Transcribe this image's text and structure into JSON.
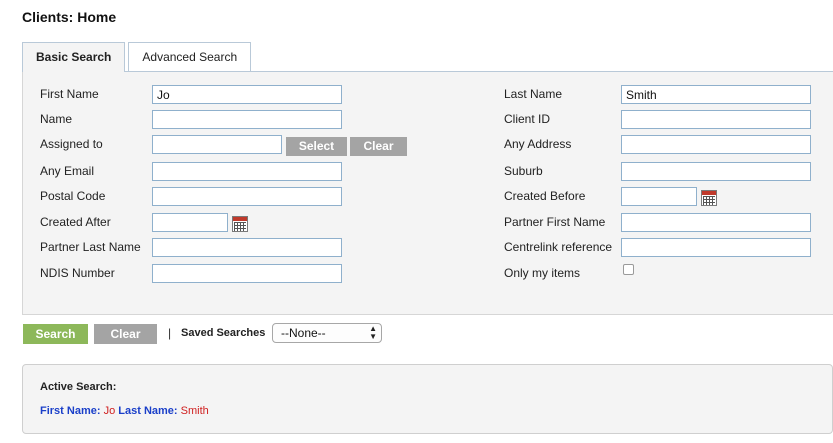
{
  "page": {
    "title": "Clients: Home"
  },
  "tabs": [
    {
      "label": "Basic Search",
      "active": true
    },
    {
      "label": "Advanced Search",
      "active": false
    }
  ],
  "form": {
    "first_name": {
      "label": "First Name",
      "value": "Jo"
    },
    "last_name": {
      "label": "Last Name",
      "value": "Smith"
    },
    "name": {
      "label": "Name",
      "value": ""
    },
    "client_id": {
      "label": "Client ID",
      "value": ""
    },
    "assigned_to": {
      "label": "Assigned to",
      "value": "",
      "select_label": "Select",
      "clear_label": "Clear"
    },
    "any_address": {
      "label": "Any Address",
      "value": ""
    },
    "any_email": {
      "label": "Any Email",
      "value": ""
    },
    "suburb": {
      "label": "Suburb",
      "value": ""
    },
    "postal_code": {
      "label": "Postal Code",
      "value": ""
    },
    "created_before": {
      "label": "Created Before",
      "value": ""
    },
    "created_after": {
      "label": "Created After",
      "value": ""
    },
    "partner_first_name": {
      "label": "Partner First Name",
      "value": ""
    },
    "partner_last_name": {
      "label": "Partner Last Name",
      "value": ""
    },
    "centrelink_reference": {
      "label": "Centrelink reference",
      "value": ""
    },
    "ndis_number": {
      "label": "NDIS Number",
      "value": ""
    },
    "only_my_items": {
      "label": "Only my items",
      "checked": false
    }
  },
  "actions": {
    "search_label": "Search",
    "clear_label": "Clear",
    "separator": "|",
    "saved_searches_label": "Saved Searches",
    "saved_searches_value": "--None--"
  },
  "active_search": {
    "title": "Active Search:",
    "first_name_key": "First Name:",
    "first_name_value": "Jo",
    "last_name_key": "Last Name:",
    "last_name_value": "Smith"
  },
  "colors": {
    "search_button": "#8db85a",
    "gray_button": "#a4a4a4",
    "input_border": "#8fb0cc",
    "active_key": "#1a3fc9",
    "active_value": "#d02020"
  },
  "icons": {
    "calendar": "calendar-icon",
    "select_arrows": "select-arrows-icon"
  }
}
